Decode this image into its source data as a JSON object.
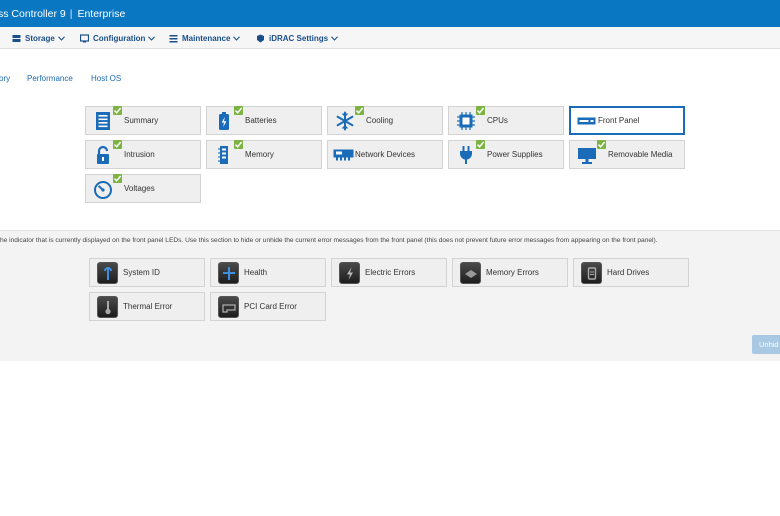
{
  "banner": {
    "title": "ss Controller 9",
    "separator": "|",
    "edition": "Enterprise"
  },
  "nav": [
    {
      "label": "Storage",
      "icon": "storage-icon"
    },
    {
      "label": "Configuration",
      "icon": "configuration-icon"
    },
    {
      "label": "Maintenance",
      "icon": "maintenance-icon"
    },
    {
      "label": "iDRAC Settings",
      "icon": "idrac-settings-icon"
    }
  ],
  "tabs": [
    "ory",
    "Performance",
    "Host OS"
  ],
  "components": [
    {
      "label": "Summary",
      "icon": "summary-icon",
      "status": "ok"
    },
    {
      "label": "Batteries",
      "icon": "battery-icon",
      "status": "ok"
    },
    {
      "label": "Cooling",
      "icon": "snowflake-icon",
      "status": "ok"
    },
    {
      "label": "CPUs",
      "icon": "cpu-icon",
      "status": "ok"
    },
    {
      "label": "Front Panel",
      "icon": "front-panel-icon",
      "status": "selected"
    },
    {
      "label": "Intrusion",
      "icon": "lock-icon",
      "status": "ok"
    },
    {
      "label": "Memory",
      "icon": "memory-icon",
      "status": "ok"
    },
    {
      "label": "Network Devices",
      "icon": "network-card-icon",
      "status": "none"
    },
    {
      "label": "Power Supplies",
      "icon": "power-plug-icon",
      "status": "ok"
    },
    {
      "label": "Removable Media",
      "icon": "monitor-icon",
      "status": "ok"
    },
    {
      "label": "Voltages",
      "icon": "gauge-icon",
      "status": "ok"
    }
  ],
  "description": "he indicator that is currently displayed on the front panel LEDs. Use this section to hide or unhide the current error messages from the front panel (this does not prevent future error messages from appearing on the front panel).",
  "errors": [
    {
      "label": "System ID",
      "icon": "system-id-icon"
    },
    {
      "label": "Health",
      "icon": "health-icon"
    },
    {
      "label": "Electric Errors",
      "icon": "electric-icon"
    },
    {
      "label": "Memory Errors",
      "icon": "memory-error-icon"
    },
    {
      "label": "Hard Drives",
      "icon": "hard-drive-icon"
    },
    {
      "label": "Thermal Error",
      "icon": "thermometer-icon"
    },
    {
      "label": "PCI Card Error",
      "icon": "pci-card-icon"
    }
  ],
  "unhide_label": "Unhid",
  "colors": {
    "banner": "#0a77c2",
    "icon_blue": "#1b6cb8",
    "status_ok": "#7cb342"
  }
}
